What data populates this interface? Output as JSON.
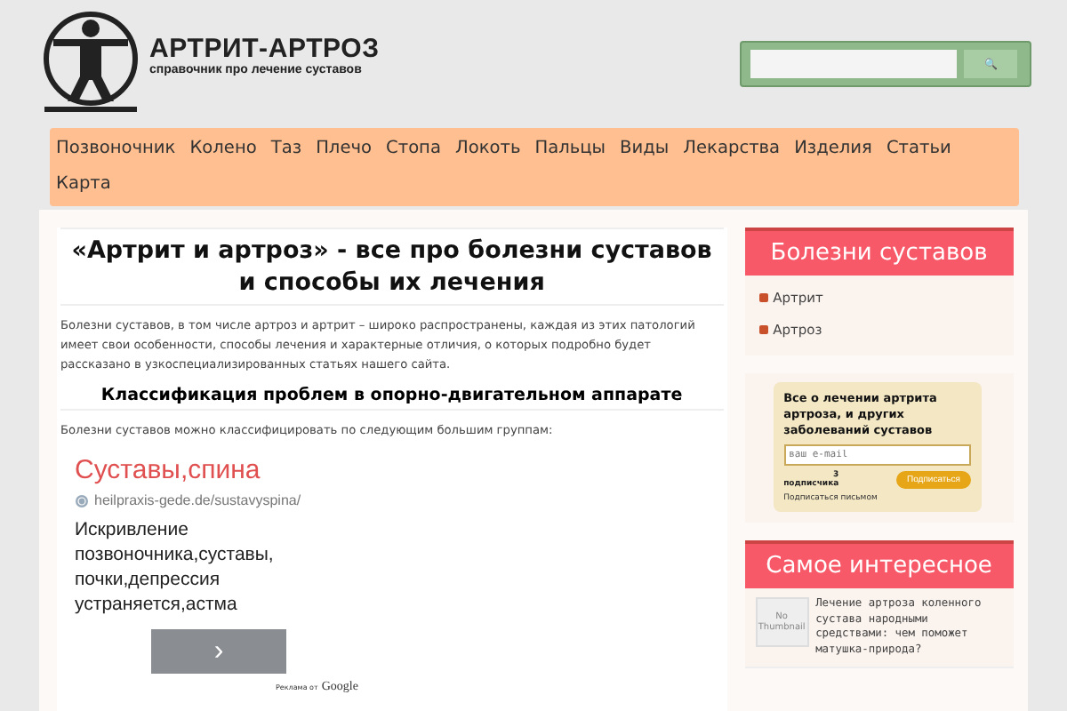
{
  "header": {
    "site_title": "АРТРИТ-АРТРОЗ",
    "site_subtitle": "справочник про лечение суставов",
    "search": {
      "button": "🔍"
    }
  },
  "nav": [
    "Позвоночник",
    "Колено",
    "Таз",
    "Плечо",
    "Стопа",
    "Локоть",
    "Пальцы",
    "Виды",
    "Лекарства",
    "Изделия",
    "Статьи",
    "Карта"
  ],
  "article": {
    "title": "«Артрит и артроз» - все про болезни суставов и способы их лечения",
    "intro": "Болезни суставов, в том числе артроз и артрит – широко распространены, каждая из этих патологий имеет свои особенности, способы лечения и характерные отличия, о которых подробно будет рассказано в узкоспециализированных статьях нашего сайта.",
    "subheading": "Классификация проблем в опорно-двигательном аппарате",
    "lead": "Болезни суставов можно классифицировать по следующим большим группам:"
  },
  "ad": {
    "title": "Суставы,спина",
    "url": "heilpraxis-gede.de/sustavyspina/",
    "text": "Искривление позвоночника,суставы, почки,депрессия устраняется,астма",
    "button": "›",
    "credit_prefix": "Реклама от",
    "credit_brand": "Google"
  },
  "sidebar": {
    "categories": {
      "title": "Болезни суставов",
      "items": [
        "Артрит",
        "Артроз"
      ]
    },
    "subscribe": {
      "title": "Все о лечении артрита артроза, и других заболеваний суставов",
      "placeholder": "ваш e-mail",
      "count": "3",
      "count_label": "подписчика",
      "button": "Подписаться",
      "note": "Подписаться письмом"
    },
    "popular": {
      "title": "Самое интересное",
      "items": [
        {
          "thumbnail": "No Thumbnail",
          "text": "Лечение артроза коленного сустава народными средствами: чем поможет матушка-природа?"
        }
      ]
    }
  }
}
